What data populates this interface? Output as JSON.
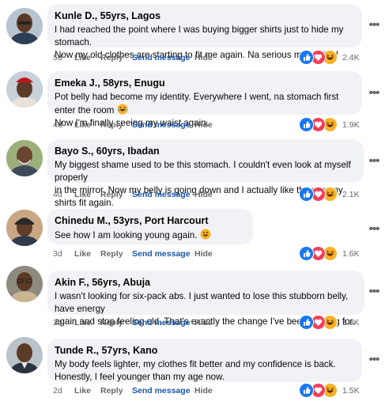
{
  "comments": [
    {
      "name": "Kunle D., 55yrs, Lagos",
      "text": "I had reached the point where I was buying bigger shirts just to hide my stomach.\nNow my old clothes are starting to fit me again. Na serious motivation!",
      "time": "5d",
      "like": "Like",
      "reply": "Reply",
      "send": "Send message",
      "hide": "Hide",
      "count": "2.4K"
    },
    {
      "name": "Emeka J., 58yrs, Enugu",
      "text": "Pot belly had become my identity. Everywhere I went, na stomach first enter the room",
      "text2": "Now I'm finally seeing my waist again.",
      "emoji": "laughing-emoji",
      "time": "4d",
      "like": "Like",
      "reply": "Reply",
      "send": "Send message",
      "hide": "Hide",
      "count": "1.9K"
    },
    {
      "name": "Bayo S., 60yrs, Ibadan",
      "text": "My biggest shame used to be this stomach. I couldn't even look at myself properly\nin the mirror. Now my belly is going down and I actually like the way my shirts fit again.",
      "time": "4d",
      "like": "Like",
      "reply": "Reply",
      "send": "Send message",
      "hide": "Hide",
      "count": "2.1K"
    },
    {
      "name": "Chinedu M., 53yrs, Port Harcourt",
      "text": "See how I am looking young again.",
      "emoji": "smile-emoji",
      "time": "3d",
      "like": "Like",
      "reply": "Reply",
      "send": "Send message",
      "hide": "Hide",
      "count": "1.6K"
    },
    {
      "name": "Akin F., 56yrs, Abuja",
      "text": "I wasn't looking for six-pack abs. I just wanted to lose this stubborn belly, have energy\nagain and stop feeling old. That's exactly the change I've been praying for.",
      "time": "3d",
      "like": "Like",
      "reply": "Reply",
      "send": "Send message",
      "hide": "Hide",
      "count": "1.8K"
    },
    {
      "name": "Tunde R., 57yrs, Kano",
      "text": "My body feels lighter, my clothes fit better and my confidence is back.\nHonestly, I feel younger than my age now.",
      "time": "2d",
      "like": "Like",
      "reply": "Reply",
      "send": "Send message",
      "hide": "Hide",
      "count": "1.5K"
    }
  ],
  "reactions": [
    "like-icon",
    "love-icon",
    "haha-icon"
  ],
  "more_glyph": "•••",
  "colors": {
    "bubble": "#f0f2f5",
    "link": "#1b56a6",
    "muted": "#65676b",
    "like": "#1877f2",
    "love": "#f33e58",
    "haha": "#f7b125"
  }
}
